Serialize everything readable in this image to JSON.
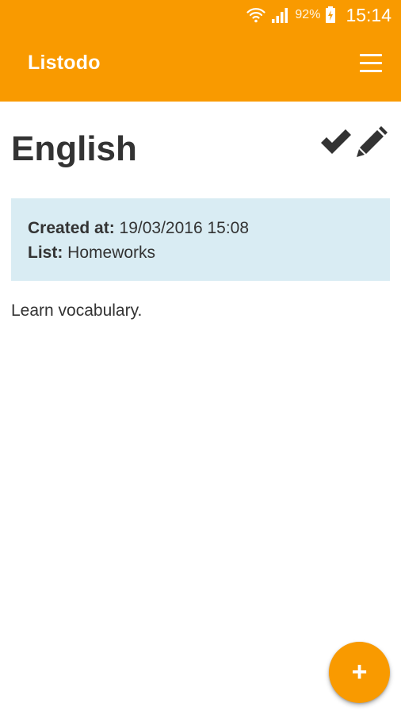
{
  "status_bar": {
    "battery_percent": "92%",
    "time": "15:14",
    "icons": [
      "wifi-icon",
      "signal-icon",
      "battery-charging-icon"
    ]
  },
  "app_bar": {
    "title": "Listodo",
    "menu_icon": "hamburger-menu-icon",
    "background_color": "#f99a00"
  },
  "task": {
    "title": "English",
    "actions": [
      {
        "icon": "checkmark-icon"
      },
      {
        "icon": "pencil-icon"
      }
    ],
    "details": {
      "created_label": "Created at:",
      "created_value": "19/03/2016 15:08",
      "list_label": "List:",
      "list_value": "Homeworks"
    },
    "description": "Learn vocabulary."
  },
  "fab": {
    "label": "+",
    "icon": "plus-icon"
  }
}
